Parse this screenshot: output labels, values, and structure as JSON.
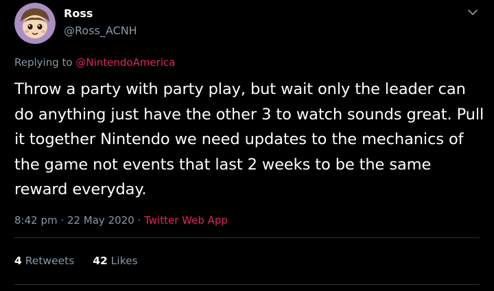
{
  "user": {
    "name": "Ross",
    "handle": "@Ross_ACNH"
  },
  "reply": {
    "prefix": "Replying to",
    "mention": "@NintendoAmerica"
  },
  "tweet": {
    "text": "Throw a party with party play, but wait only the leader can do anything just have the other 3 to watch sounds great. Pull it together Nintendo we need updates to the mechanics of the game not events that last 2 weeks to be the same reward everyday."
  },
  "meta": {
    "time": "8:42 pm",
    "separator1": "·",
    "date": "22 May 2020",
    "separator2": "·",
    "source": "Twitter Web App"
  },
  "stats": {
    "retweets_count": "4",
    "retweets_label": "Retweets",
    "likes_count": "42",
    "likes_label": "Likes"
  },
  "colors": {
    "background": "#000000",
    "text_primary": "#ffffff",
    "text_secondary": "#8899a6",
    "accent": "#e0245e",
    "divider": "#2f3336"
  },
  "icons": {
    "more": "chevron-down-icon",
    "avatar": "avatar"
  }
}
